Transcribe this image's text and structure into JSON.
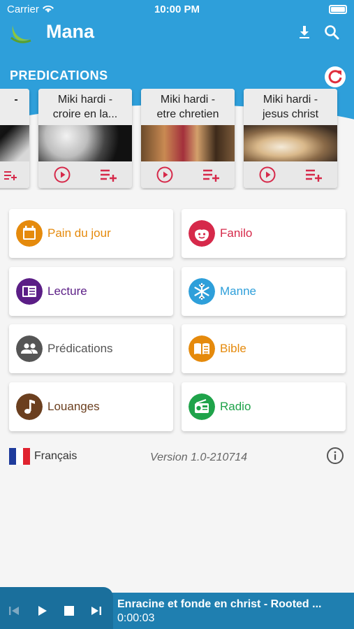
{
  "status_bar": {
    "carrier": "Carrier",
    "time": "10:00 PM"
  },
  "app": {
    "title": "Mana",
    "accent_color": "#2e9fda",
    "download_icon": "download-icon",
    "search_icon": "search-icon"
  },
  "predications": {
    "section_title": "PREDICATIONS",
    "refresh_icon": "refresh-icon",
    "cards": [
      {
        "title_line1": "",
        "title_line2": "",
        "partial": true
      },
      {
        "title_line1": "Miki hardi -",
        "title_line2": "croire en la..."
      },
      {
        "title_line1": "Miki hardi -",
        "title_line2": "etre chretien"
      },
      {
        "title_line1": "Miki hardi -",
        "title_line2": "jesus christ"
      }
    ]
  },
  "menu": [
    {
      "label": "Pain du jour",
      "color": "#e58a0c",
      "icon": "calendar-icon"
    },
    {
      "label": "Fanilo",
      "color": "#d6294a",
      "icon": "child-face-icon"
    },
    {
      "label": "Lecture",
      "color": "#5b1e86",
      "icon": "book-reader-icon"
    },
    {
      "label": "Manne",
      "color": "#2e9fda",
      "icon": "snowflake-icon"
    },
    {
      "label": "Prédications",
      "color": "#555555",
      "icon": "group-icon"
    },
    {
      "label": "Bible",
      "color": "#e58a0c",
      "icon": "open-book-icon"
    },
    {
      "label": "Louanges",
      "color": "#6b3f1f",
      "icon": "music-note-icon"
    },
    {
      "label": "Radio",
      "color": "#1fa34a",
      "icon": "radio-icon"
    }
  ],
  "footer": {
    "language": "Français",
    "version": "Version 1.0-210714"
  },
  "player": {
    "title": "Enracine et fonde en christ - Rooted ...",
    "time": "0:00:03"
  }
}
